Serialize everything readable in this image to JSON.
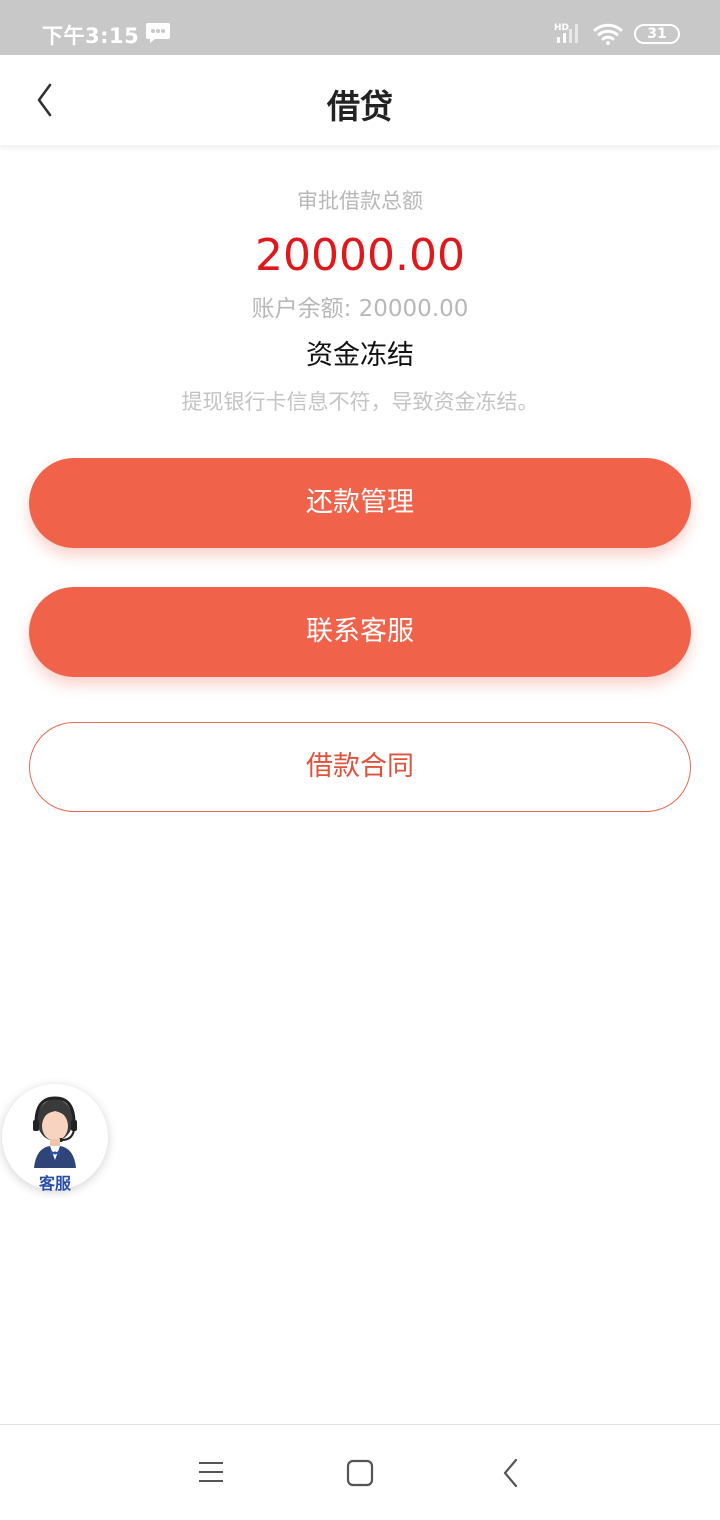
{
  "status_bar": {
    "time": "下午3:15",
    "network_label": "HD",
    "battery": "31"
  },
  "header": {
    "title": "借贷"
  },
  "summary": {
    "label": "审批借款总额",
    "amount": "20000.00",
    "balance": "账户余额: 20000.00",
    "status": "资金冻结",
    "reason": "提现银行卡信息不符，导致资金冻结。"
  },
  "actions": {
    "repay_label": "还款管理",
    "service_label": "联系客服",
    "contract_label": "借款合同"
  },
  "floating_service": {
    "label": "客服",
    "icon": "customer-service-avatar-icon"
  },
  "nav": {
    "icons": [
      "menu-icon",
      "home-icon",
      "back-icon"
    ]
  },
  "colors": {
    "accent": "#f0624a",
    "amount": "#e2171b",
    "status_bar": "#c8c8c8"
  }
}
